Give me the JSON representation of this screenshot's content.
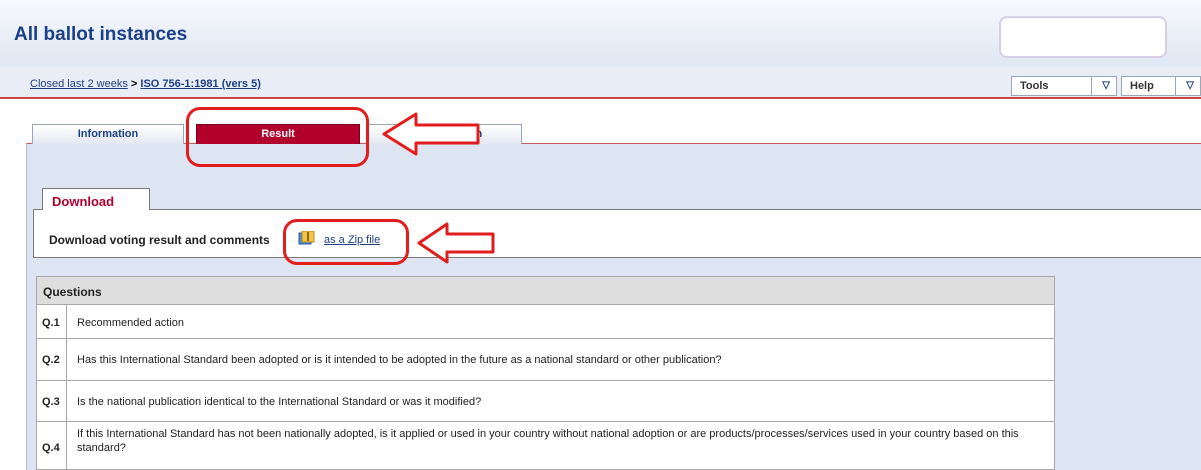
{
  "header": {
    "title": "All ballot instances"
  },
  "breadcrumb": {
    "parent": "Closed last 2 weeks",
    "separator": ">",
    "current": "ISO 756-1:1981 (vers 5)"
  },
  "menus": {
    "tools": "Tools",
    "help": "Help",
    "dropdown_glyph": "▽"
  },
  "tabs": {
    "information": "Information",
    "result": "Result",
    "third": "ation"
  },
  "download": {
    "title": "Download",
    "label": "Download voting result and comments",
    "zip_link": "as a Zip file"
  },
  "questions": {
    "header": "Questions",
    "rows": [
      {
        "num": "Q.1",
        "text": "Recommended action"
      },
      {
        "num": "Q.2",
        "text": "Has this International Standard been adopted or is it intended to be adopted in the future as a national standard or other publication?"
      },
      {
        "num": "Q.3",
        "text": "Is the national publication identical to the International Standard or was it modified?"
      },
      {
        "num": "Q.4",
        "text": "If this International Standard has not been nationally adopted, is it applied or used in your country without national adoption or are products/processes/services used in your country based on this standard?"
      }
    ]
  },
  "colors": {
    "title_blue": "#1c3f8a",
    "active_tab": "#b2002c",
    "annotation_red": "#e11d1d"
  },
  "icons": {
    "zip": "zip-file-icon",
    "dropdown": "triangle-down-icon"
  }
}
